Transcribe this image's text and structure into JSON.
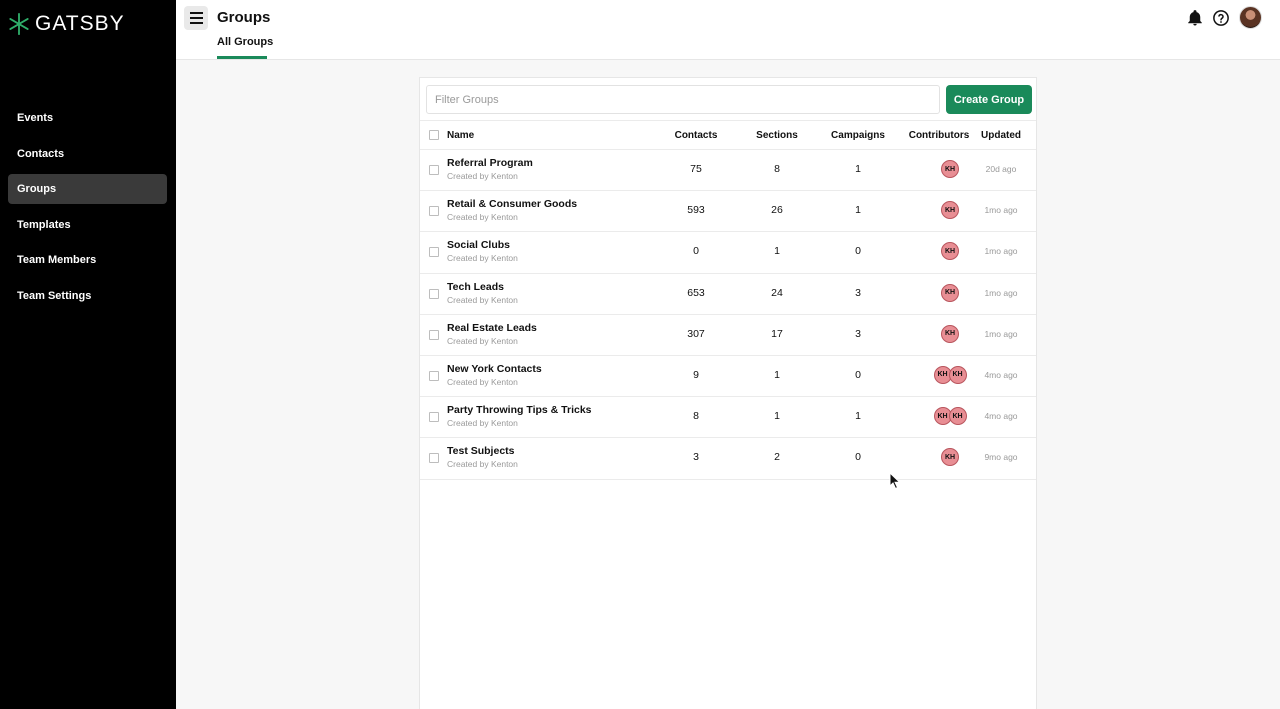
{
  "brand": {
    "name": "GATSBY",
    "accent": "#1a8a5a"
  },
  "sidebar": {
    "items": [
      {
        "label": "Events",
        "active": false
      },
      {
        "label": "Contacts",
        "active": false
      },
      {
        "label": "Groups",
        "active": true
      },
      {
        "label": "Templates",
        "active": false
      },
      {
        "label": "Team Members",
        "active": false
      },
      {
        "label": "Team Settings",
        "active": false
      }
    ]
  },
  "header": {
    "title": "Groups",
    "tabs": [
      {
        "label": "All Groups",
        "active": true
      }
    ],
    "icons": [
      "hamburger-menu-icon",
      "bell-icon",
      "help-circle-icon",
      "user-avatar"
    ]
  },
  "toolbar": {
    "filter_placeholder": "Filter Groups",
    "create_label": "Create Group"
  },
  "table": {
    "columns": {
      "name": "Name",
      "contacts": "Contacts",
      "sections": "Sections",
      "campaigns": "Campaigns",
      "contributors": "Contributors",
      "updated": "Updated"
    },
    "rows": [
      {
        "name": "Referral Program",
        "creator": "Created by Kenton",
        "contacts": "75",
        "sections": "8",
        "campaigns": "1",
        "contributors": [
          "KH"
        ],
        "updated": "20d ago"
      },
      {
        "name": "Retail & Consumer Goods",
        "creator": "Created by Kenton",
        "contacts": "593",
        "sections": "26",
        "campaigns": "1",
        "contributors": [
          "KH"
        ],
        "updated": "1mo ago"
      },
      {
        "name": "Social Clubs",
        "creator": "Created by Kenton",
        "contacts": "0",
        "sections": "1",
        "campaigns": "0",
        "contributors": [
          "KH"
        ],
        "updated": "1mo ago"
      },
      {
        "name": "Tech Leads",
        "creator": "Created by Kenton",
        "contacts": "653",
        "sections": "24",
        "campaigns": "3",
        "contributors": [
          "KH"
        ],
        "updated": "1mo ago"
      },
      {
        "name": "Real Estate Leads",
        "creator": "Created by Kenton",
        "contacts": "307",
        "sections": "17",
        "campaigns": "3",
        "contributors": [
          "KH"
        ],
        "updated": "1mo ago"
      },
      {
        "name": "New York Contacts",
        "creator": "Created by Kenton",
        "contacts": "9",
        "sections": "1",
        "campaigns": "0",
        "contributors": [
          "KH",
          "KH"
        ],
        "updated": "4mo ago"
      },
      {
        "name": "Party Throwing Tips & Tricks",
        "creator": "Created by Kenton",
        "contacts": "8",
        "sections": "1",
        "campaigns": "1",
        "contributors": [
          "KH",
          "KH"
        ],
        "updated": "4mo ago"
      },
      {
        "name": "Test Subjects",
        "creator": "Created by Kenton",
        "contacts": "3",
        "sections": "2",
        "campaigns": "0",
        "contributors": [
          "KH"
        ],
        "updated": "9mo ago"
      }
    ]
  }
}
